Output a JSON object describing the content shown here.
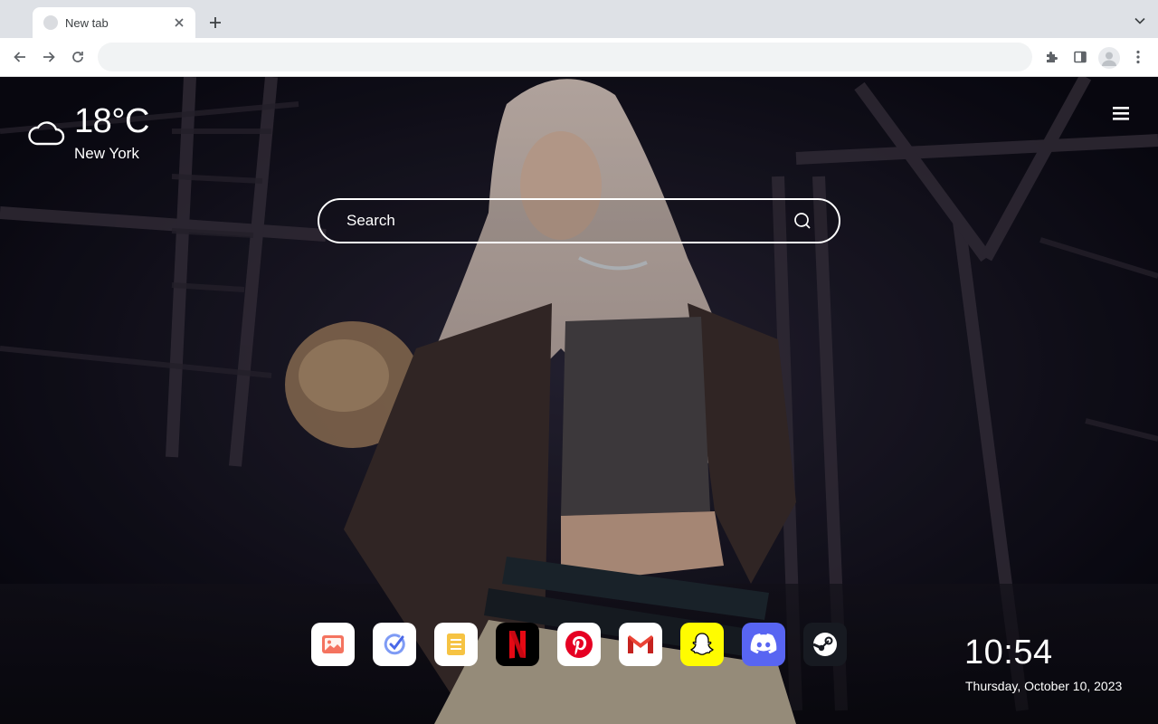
{
  "browser": {
    "tab": {
      "title": "New tab"
    },
    "omnibox": {
      "value": "",
      "placeholder": ""
    },
    "icons": [
      "back-icon",
      "forward-icon",
      "reload-icon",
      "extensions-icon",
      "side-panel-icon",
      "profile-icon",
      "more-icon",
      "close-icon",
      "plus-icon",
      "chevron-down-icon"
    ]
  },
  "weather": {
    "temperature": "18°C",
    "city": "New York",
    "icon": "cloud-icon"
  },
  "search": {
    "placeholder": "Search"
  },
  "dock": [
    {
      "name": "Gallery",
      "icon": "gallery-icon",
      "color": "#f4735f"
    },
    {
      "name": "To Do",
      "icon": "todo-check-icon",
      "color": "#5b7bf2"
    },
    {
      "name": "Notes",
      "icon": "notes-icon",
      "color": "#f6c343"
    },
    {
      "name": "Netflix",
      "icon": "netflix-icon",
      "color": "#e50914"
    },
    {
      "name": "Pinterest",
      "icon": "pinterest-icon",
      "color": "#e60023"
    },
    {
      "name": "Gmail",
      "icon": "gmail-icon",
      "color": "#ea4335"
    },
    {
      "name": "Snapchat",
      "icon": "snapchat-icon",
      "color": "#fffc00"
    },
    {
      "name": "Discord",
      "icon": "discord-icon",
      "color": "#5865f2"
    },
    {
      "name": "Steam",
      "icon": "steam-icon",
      "color": "#171a21"
    }
  ],
  "clock": {
    "time": "10:54",
    "date": "Thursday, October 10, 2023"
  }
}
